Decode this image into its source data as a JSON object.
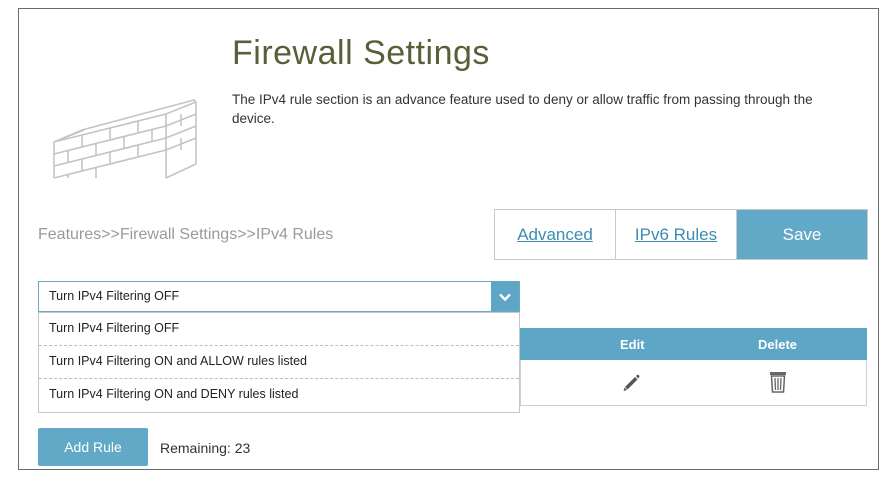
{
  "header": {
    "title": "Firewall Settings",
    "description": "The IPv4 rule section is an advance feature used to deny or allow traffic from passing through the device."
  },
  "breadcrumb": "Features>>Firewall Settings>>IPv4 Rules",
  "topbar": {
    "advanced_label": "Advanced",
    "ipv6_label": "IPv6 Rules",
    "save_label": "Save"
  },
  "filter": {
    "selected": "Turn IPv4 Filtering OFF",
    "options": [
      "Turn IPv4 Filtering OFF",
      "Turn IPv4 Filtering ON and ALLOW rules listed",
      "Turn IPv4 Filtering ON and DENY rules listed"
    ]
  },
  "table": {
    "columns": [
      "Edit",
      "Delete"
    ]
  },
  "footer": {
    "add_label": "Add Rule",
    "remaining": "Remaining: 23"
  },
  "colors": {
    "accent": "#61a9c7",
    "link": "#3c8cb4",
    "title": "#5a5f3a"
  },
  "icons": [
    "brick-wall-icon",
    "chevron-down-icon",
    "pencil-icon",
    "trash-icon"
  ]
}
